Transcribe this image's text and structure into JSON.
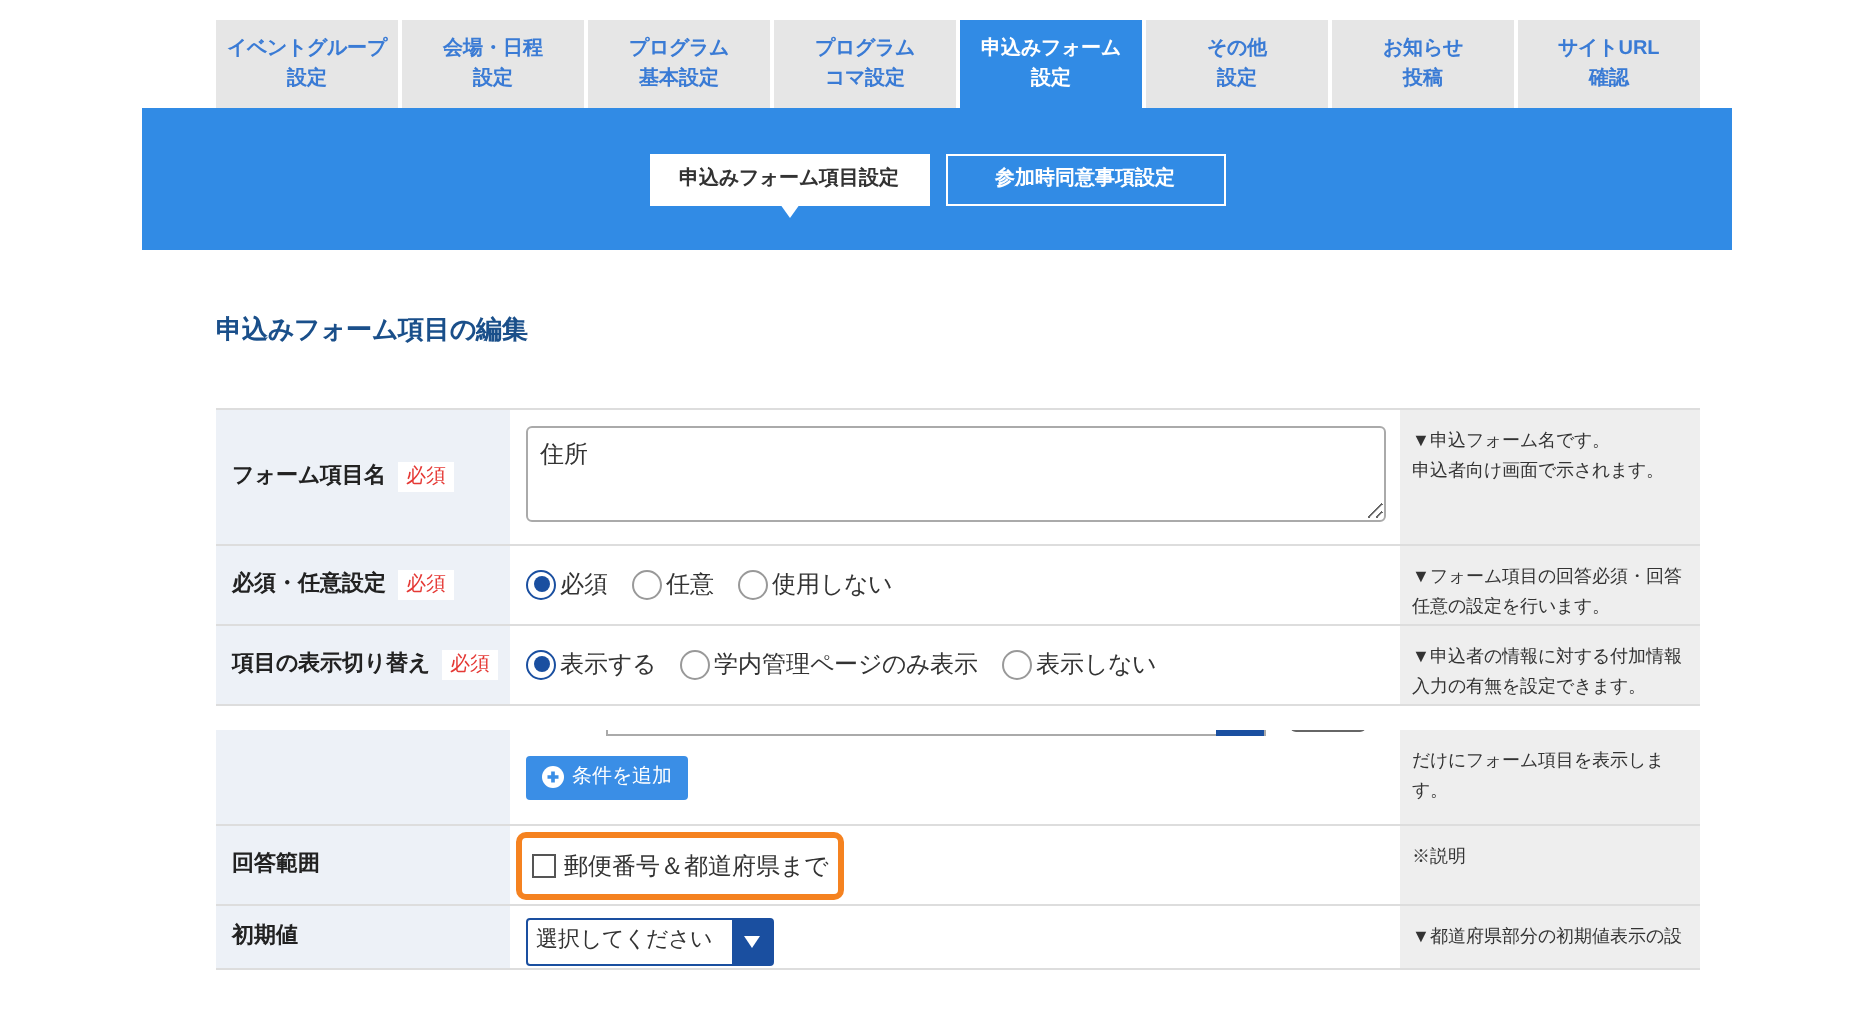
{
  "tabs": [
    {
      "label": [
        "イベントグループ",
        "設定"
      ],
      "selected": false
    },
    {
      "label": [
        "会場・日程",
        "設定"
      ],
      "selected": false
    },
    {
      "label": [
        "プログラム",
        "基本設定"
      ],
      "selected": false
    },
    {
      "label": [
        "プログラム",
        "コマ設定"
      ],
      "selected": false
    },
    {
      "label": [
        "申込みフォーム",
        "設定"
      ],
      "selected": true
    },
    {
      "label": [
        "その他",
        "設定"
      ],
      "selected": false
    },
    {
      "label": [
        "お知らせ",
        "投稿"
      ],
      "selected": false
    },
    {
      "label": [
        "サイトURL",
        "確認"
      ],
      "selected": false
    }
  ],
  "subtabs": [
    {
      "label": "申込みフォーム項目設定",
      "selected": true
    },
    {
      "label": "参加時同意事項設定",
      "selected": false
    }
  ],
  "heading": "申込みフォーム項目の編集",
  "rows": [
    {
      "kind": "textarea",
      "label": "フォーム項目名",
      "badge": "必須",
      "value": "住所",
      "help": [
        "▼申込フォーム名です。",
        "申込者向け画面で示されます。"
      ]
    },
    {
      "kind": "radio",
      "label": "必須・任意設定",
      "badge": "必須",
      "options": [
        {
          "label": "必須",
          "selected": true
        },
        {
          "label": "任意",
          "selected": false
        },
        {
          "label": "使用しない",
          "selected": false
        }
      ],
      "help": [
        "▼フォーム項目の回答必須・回答",
        "任意の設定を行います。"
      ]
    },
    {
      "kind": "radio",
      "label": "項目の表示切り替え",
      "badge": "必須",
      "options": [
        {
          "label": "表示する",
          "selected": true
        },
        {
          "label": "学内管理ページのみ表示",
          "selected": false
        },
        {
          "label": "表示しない",
          "selected": false
        }
      ],
      "help": [
        "▼申込者の情報に対する付加情報",
        "入力の有無を設定できます。"
      ]
    },
    {
      "kind": "condition",
      "button": "条件を追加",
      "help": [
        "だけにフォーム項目を表示しま",
        "す。"
      ]
    },
    {
      "kind": "checkbox",
      "label": "回答範囲",
      "option": {
        "label": "郵便番号＆都道府県まで",
        "checked": false
      },
      "highlighted": true,
      "help": [
        "※説明"
      ]
    },
    {
      "kind": "select",
      "label": "初期値",
      "value": "選択してください",
      "help": [
        "▼都道府県部分の初期値表示の設"
      ]
    }
  ]
}
